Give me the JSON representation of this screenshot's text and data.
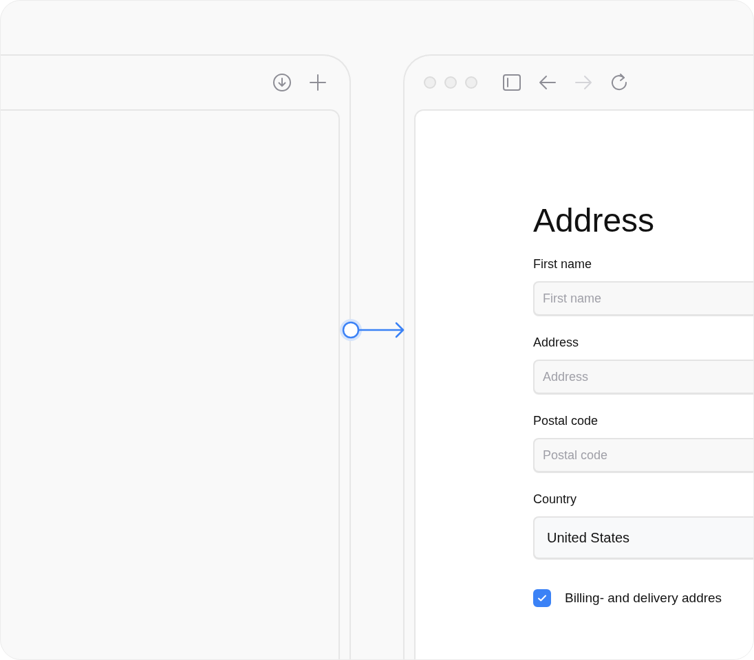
{
  "browser": {
    "back_disabled": false,
    "forward_disabled": true
  },
  "form": {
    "title": "Address",
    "fields": [
      {
        "kind": "text",
        "label": "First name",
        "placeholder": "First name"
      },
      {
        "kind": "text",
        "label": "Address",
        "placeholder": "Address"
      },
      {
        "kind": "text",
        "label": "Postal code",
        "placeholder": "Postal code"
      },
      {
        "kind": "select",
        "label": "Country",
        "value": "United States"
      }
    ],
    "checkbox": {
      "label": "Billing- and delivery addres",
      "checked": true
    }
  }
}
